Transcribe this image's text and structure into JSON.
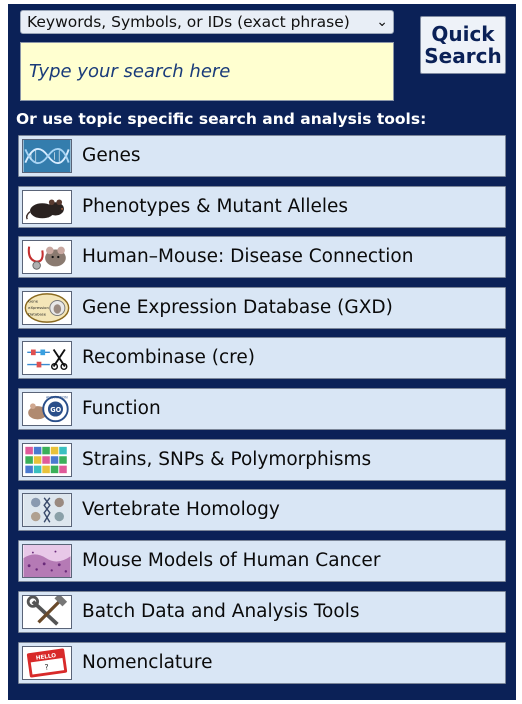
{
  "search": {
    "scope_value": "Keywords, Symbols, or IDs (exact phrase)",
    "placeholder": "Type your search here",
    "quick_search_line1": "Quick",
    "quick_search_line2": "Search"
  },
  "intro_text": "Or use topic specific search and analysis tools:",
  "tools": [
    {
      "label": "Genes",
      "icon": "dna-helix-icon"
    },
    {
      "label": "Phenotypes & Mutant Alleles",
      "icon": "mouse-photo-icon"
    },
    {
      "label": "Human–Mouse: Disease Connection",
      "icon": "stethoscope-mouse-icon"
    },
    {
      "label": "Gene Expression Database (GXD)",
      "icon": "gxd-logo-icon"
    },
    {
      "label": "Recombinase (cre)",
      "icon": "recombinase-scissors-icon"
    },
    {
      "label": "Function",
      "icon": "gene-ontology-annotation-icon"
    },
    {
      "label": "Strains, SNPs & Polymorphisms",
      "icon": "snp-grid-icon"
    },
    {
      "label": "Vertebrate Homology",
      "icon": "homology-icon"
    },
    {
      "label": "Mouse Models of Human Cancer",
      "icon": "tissue-histology-icon"
    },
    {
      "label": "Batch Data and Analysis Tools",
      "icon": "wrench-hammer-icon"
    },
    {
      "label": "Nomenclature",
      "icon": "hello-name-tag-icon"
    }
  ],
  "icon_tags": {
    "gxd": [
      "Gene",
      "eXpression",
      "Database"
    ],
    "nametag": "HELLO",
    "nametag_mark": "?",
    "go_ring": "ANNOTATION",
    "go_center": "GO"
  }
}
